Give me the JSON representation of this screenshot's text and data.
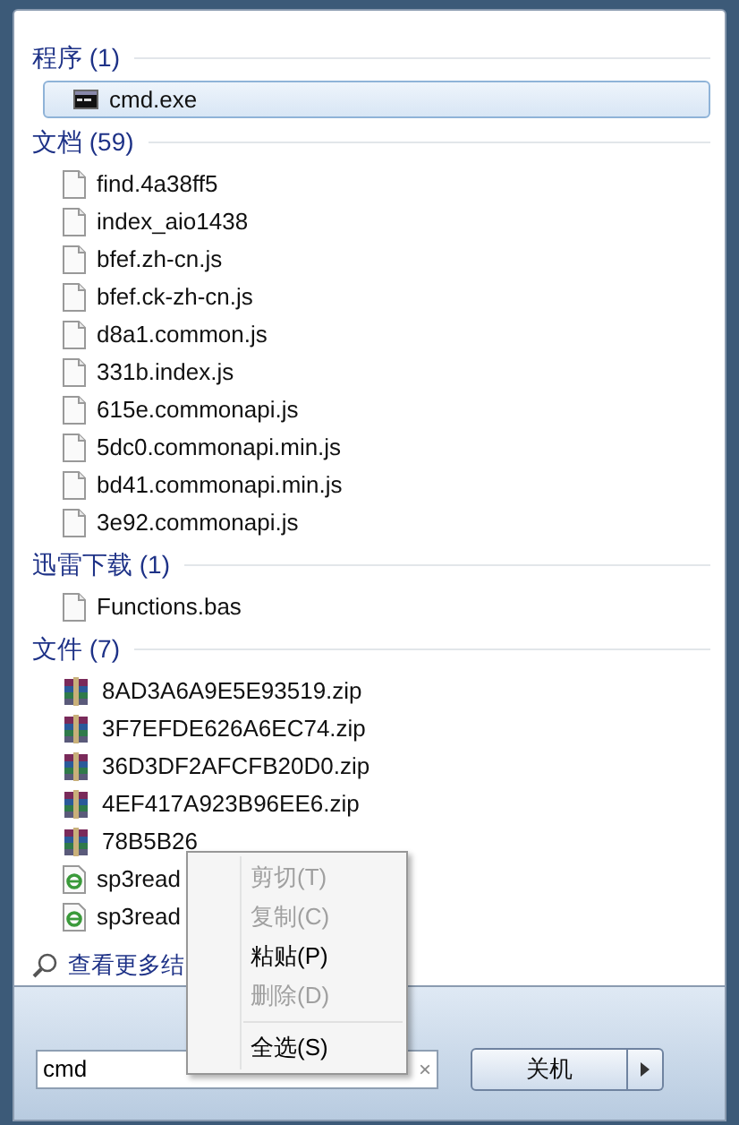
{
  "groups": [
    {
      "title": "程序 (1)",
      "items": [
        {
          "name": "cmd.exe",
          "kind": "console",
          "selected": true
        }
      ]
    },
    {
      "title": "文档 (59)",
      "items": [
        {
          "name": "find.4a38ff5",
          "kind": "file",
          "selected": false
        },
        {
          "name": "index_aio1438",
          "kind": "file",
          "selected": false
        },
        {
          "name": "bfef.zh-cn.js",
          "kind": "file",
          "selected": false
        },
        {
          "name": "bfef.ck-zh-cn.js",
          "kind": "file",
          "selected": false
        },
        {
          "name": "d8a1.common.js",
          "kind": "file",
          "selected": false
        },
        {
          "name": "331b.index.js",
          "kind": "file",
          "selected": false
        },
        {
          "name": "615e.commonapi.js",
          "kind": "file",
          "selected": false
        },
        {
          "name": "5dc0.commonapi.min.js",
          "kind": "file",
          "selected": false
        },
        {
          "name": "bd41.commonapi.min.js",
          "kind": "file",
          "selected": false
        },
        {
          "name": "3e92.commonapi.js",
          "kind": "file",
          "selected": false
        }
      ]
    },
    {
      "title": "迅雷下载 (1)",
      "items": [
        {
          "name": "Functions.bas",
          "kind": "file",
          "selected": false
        }
      ]
    },
    {
      "title": "文件 (7)",
      "items": [
        {
          "name": "8AD3A6A9E5E93519.zip",
          "kind": "archive",
          "selected": false
        },
        {
          "name": "3F7EFDE626A6EC74.zip",
          "kind": "archive",
          "selected": false
        },
        {
          "name": "36D3DF2AFCFB20D0.zip",
          "kind": "archive",
          "selected": false
        },
        {
          "name": "4EF417A923B96EE6.zip",
          "kind": "archive",
          "selected": false
        },
        {
          "name": "78B5B26",
          "kind": "archive",
          "selected": false
        },
        {
          "name": "sp3read",
          "kind": "webpage",
          "selected": false
        },
        {
          "name": "sp3read",
          "kind": "webpage",
          "selected": false
        }
      ]
    }
  ],
  "more_results": "查看更多结",
  "search": {
    "value": "cmd",
    "clear": "×"
  },
  "shutdown_button": "关机",
  "context_menu": [
    {
      "label": "剪切(T)",
      "disabled": true
    },
    {
      "label": "复制(C)",
      "disabled": true
    },
    {
      "label": "粘贴(P)",
      "disabled": false
    },
    {
      "label": "删除(D)",
      "disabled": true
    },
    {
      "kind": "separator"
    },
    {
      "label": "全选(S)",
      "disabled": false
    }
  ]
}
